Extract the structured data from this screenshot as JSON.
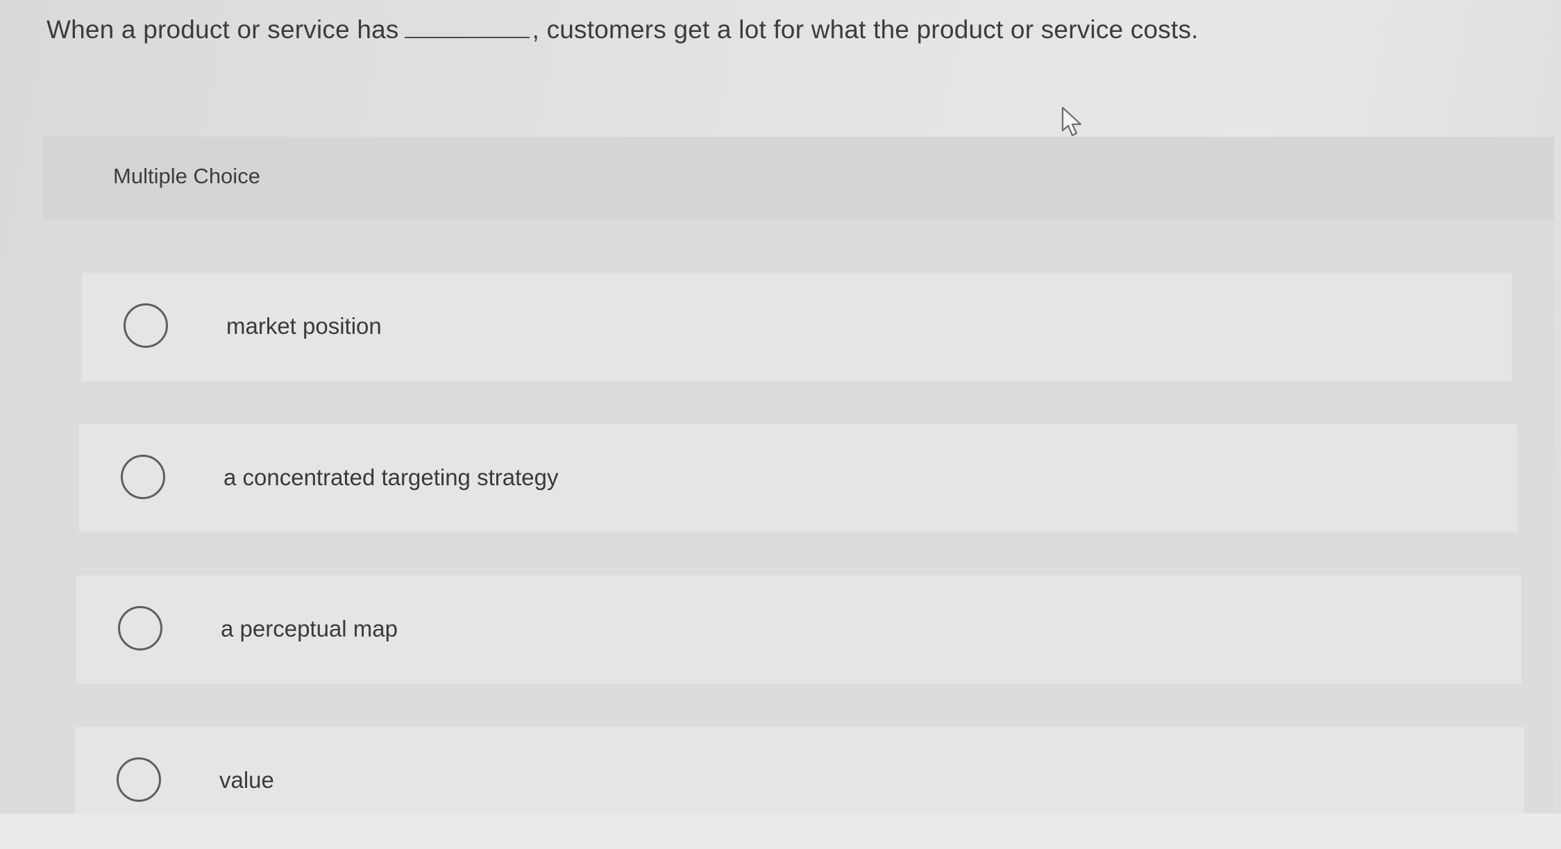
{
  "question": {
    "before_blank": "When a product or service has",
    "after_blank": ", customers get a lot for what the product or service costs."
  },
  "section_label": "Multiple Choice",
  "options": [
    {
      "label": "market position"
    },
    {
      "label": "a concentrated targeting strategy"
    },
    {
      "label": "a perceptual map"
    },
    {
      "label": "value"
    }
  ],
  "icons": {
    "cursor": "mouse-pointer-icon",
    "radio": "radio-circle-icon"
  },
  "colors": {
    "background": "#e2e3e4",
    "panel": "#dbdcdd",
    "option_row": "#e4e5e6",
    "text": "#3c3c3e",
    "radio_border": "#5d5e60"
  }
}
